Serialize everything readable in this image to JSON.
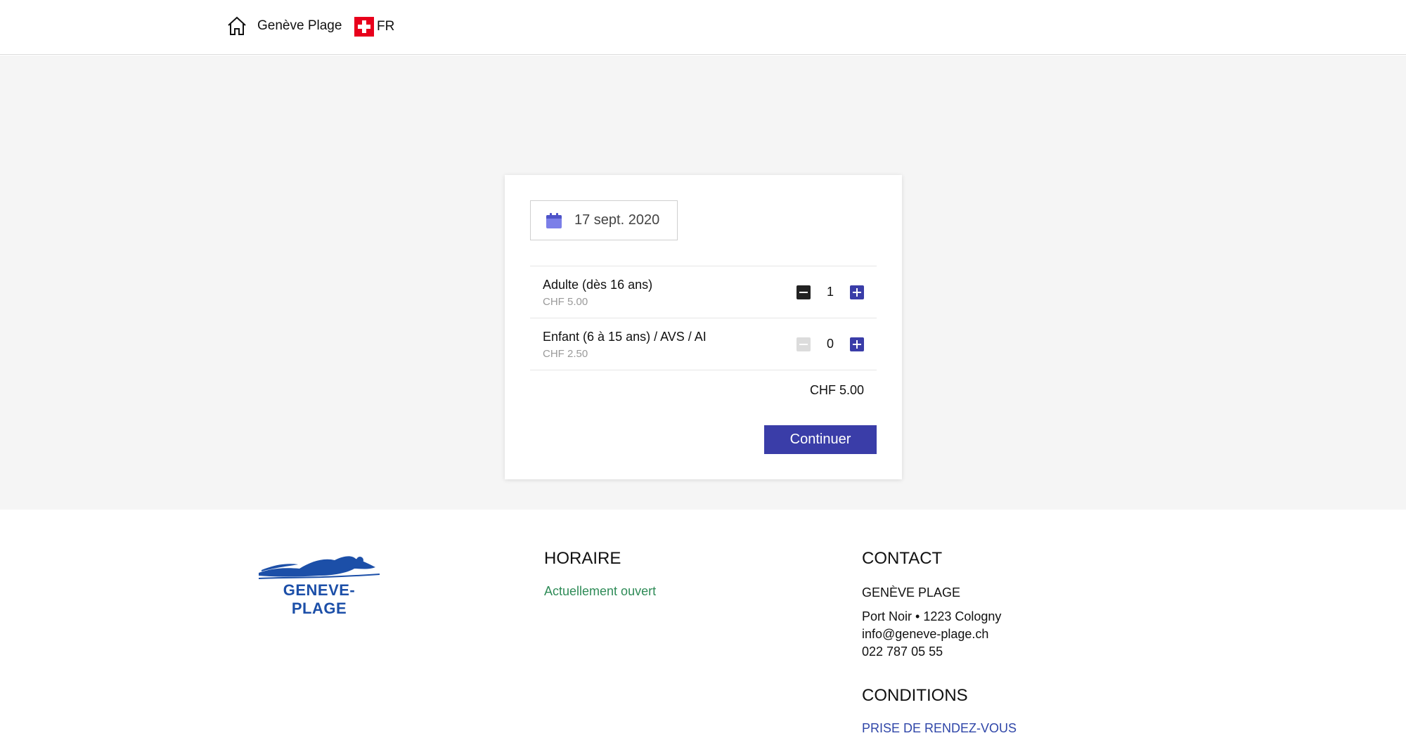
{
  "header": {
    "home_label": "Genève Plage",
    "lang_label": "FR"
  },
  "booking": {
    "date": "17 sept. 2020",
    "tickets": [
      {
        "title": "Adulte (dès 16 ans)",
        "price": "CHF 5.00",
        "quantity": "1",
        "minus_enabled": true
      },
      {
        "title": "Enfant (6 à 15 ans) / AVS / AI",
        "price": "CHF 2.50",
        "quantity": "0",
        "minus_enabled": false
      }
    ],
    "total": "CHF 5.00",
    "continue_label": "Continuer"
  },
  "footer": {
    "logo_text": "GENEVE-PLAGE",
    "horaire": {
      "title": "HORAIRE",
      "status": "Actuellement ouvert"
    },
    "contact": {
      "title": "CONTACT",
      "name": "GENÈVE PLAGE",
      "address": "Port Noir • 1223 Cologny",
      "email": "info@geneve-plage.ch",
      "phone": "022 787 05 55"
    },
    "conditions": {
      "title": "CONDITIONS",
      "link": "PRISE DE RENDEZ-VOUS"
    }
  },
  "colors": {
    "accent": "#3a3da8",
    "status_open": "#2e8b57",
    "logo_blue": "#1c4fa8",
    "flag_red": "#e8001c"
  }
}
